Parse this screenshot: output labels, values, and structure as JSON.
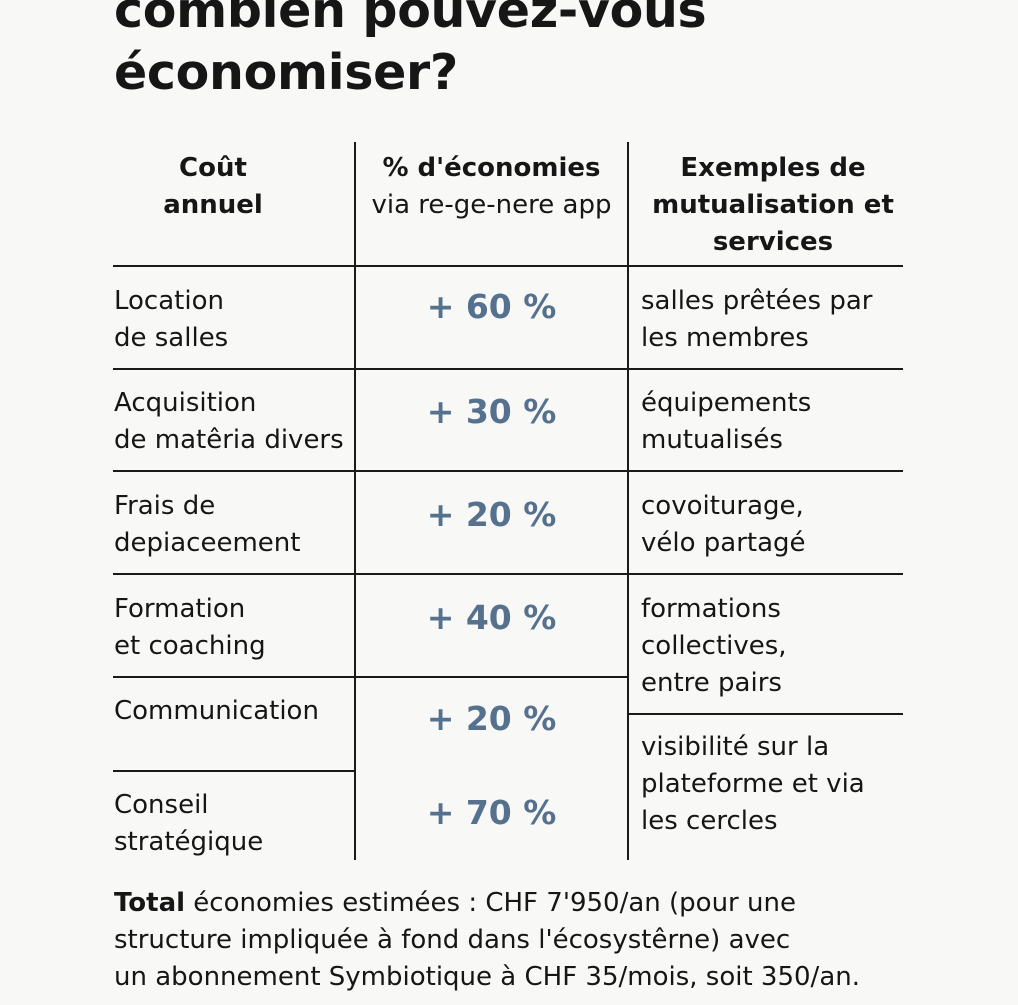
{
  "title": {
    "line1": "combien pouvez-vous",
    "line2": "économiser?"
  },
  "table": {
    "headers": {
      "cost": [
        "Coût",
        "annuel"
      ],
      "savings_bold": "% d'économies",
      "savings_sub": "via re-ge-nere app",
      "examples": [
        "Exemples de",
        "mutualisation et",
        "services"
      ]
    },
    "rows": [
      {
        "cost": [
          "Location",
          "de salles"
        ],
        "pct": "+ 60 %"
      },
      {
        "cost": [
          "Acquisition",
          "de matêria divers"
        ],
        "pct": "+ 30 %"
      },
      {
        "cost": [
          "Frais de",
          "depiaceement"
        ],
        "pct": "+ 20 %"
      },
      {
        "cost": [
          "Formation",
          "et coaching"
        ],
        "pct": "+ 40 %"
      },
      {
        "cost": [
          "Communication"
        ],
        "pct": "+ 20 %"
      },
      {
        "cost": [
          "Conseil",
          "stratégique"
        ],
        "pct": "+ 70 %"
      }
    ],
    "examples": [
      [
        "salles prêtées par",
        "les membres"
      ],
      [
        "équipements",
        "mutualisés"
      ],
      [
        "covoiturage,",
        "vélo partagé"
      ],
      [
        "formations",
        "collectives,",
        "entre pairs"
      ],
      [
        "visibilité sur la",
        "plateforme et via",
        "les cercles"
      ]
    ]
  },
  "total": {
    "label": "Total",
    "line1_rest": " économies estimées : CHF 7'950/an (pour une",
    "line2": "structure impliquée à fond dans l'écosystêrne) avec",
    "line3": "un abonnement Symbiotique à CHF 35/mois, soit 350/an."
  },
  "colors": {
    "percentage": "#55718e",
    "text": "#161616",
    "background": "#f8f8f6"
  }
}
